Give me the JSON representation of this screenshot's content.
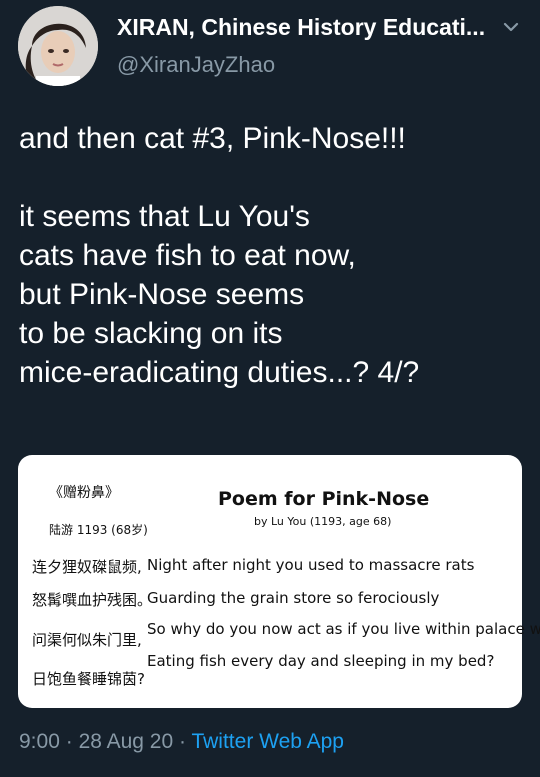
{
  "author": {
    "display_name": "XIRAN, Chinese History Educati...",
    "handle": "@XiranJayZhao"
  },
  "tweet": {
    "text": "and then cat #3, Pink-Nose!!!\n\nit seems that Lu You's\ncats have fish to eat now,\nbut Pink-Nose seems\nto be slacking on its\nmice-eradicating duties...? 4/?"
  },
  "image_card": {
    "title_cn": "《赠粉鼻》",
    "author_cn": "陆游 1193 (68岁)",
    "title_en": "Poem for Pink-Nose",
    "byline_en": "by Lu You (1193, age 68)",
    "cn_lines": [
      "连夕狸奴磔鼠频,",
      "怒髯噀血护残囷。",
      "问渠何似朱门里,",
      "日饱鱼餐睡锦茵?"
    ],
    "en_lines": [
      "Night after night you used to massacre rats",
      "Guarding the grain store so ferociously",
      "So why do you now act as if you live within palace walls",
      "Eating fish every day and sleeping in my bed?"
    ]
  },
  "meta": {
    "time": "9:00",
    "separator": "·",
    "date": "28 Aug 20",
    "source": "Twitter Web App"
  },
  "icons": {
    "menu": "chevron-down-icon",
    "avatar": "avatar"
  },
  "colors": {
    "background": "#15202b",
    "primary_text": "#ffffff",
    "secondary_text": "#8899a6",
    "link": "#1da1f2"
  }
}
